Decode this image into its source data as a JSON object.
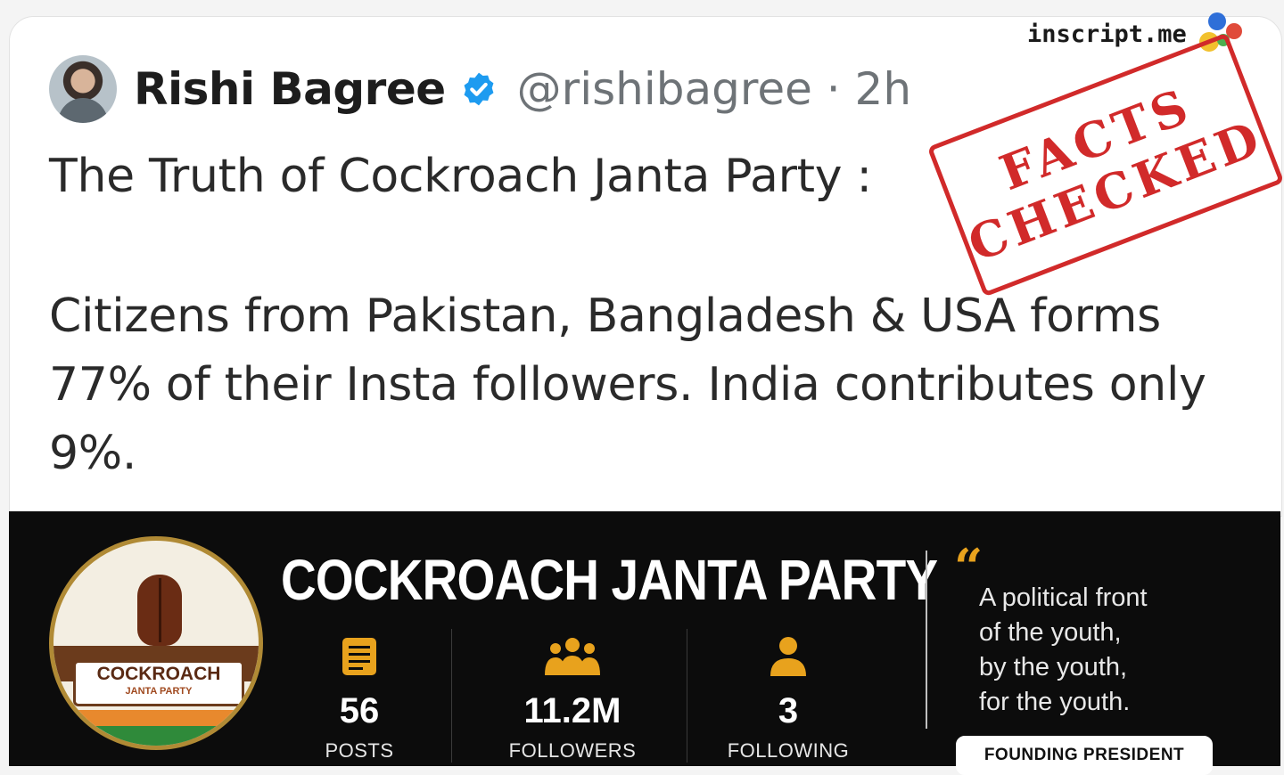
{
  "tweet": {
    "author_name": "Rishi Bagree",
    "handle_time": "@rishibagree · 2h",
    "paragraphs": [
      "The Truth of Cockroach Janta Party :",
      "Citizens from Pakistan, Bangladesh & USA forms 77% of their Insta followers. India contributes only 9%."
    ]
  },
  "watermark": {
    "text": "inscript.me",
    "dot_colors": [
      "#2f6fd8",
      "#e04a3a",
      "#f2c12e",
      "#4caf50"
    ]
  },
  "stamp": {
    "line1": "FACTS",
    "line2": "CHECKED",
    "color": "#d12a2a"
  },
  "banner": {
    "title": "COCKROACH JANTA PARTY",
    "logo": {
      "main": "COCKROACH",
      "sub": "JANTA PARTY"
    },
    "stats": [
      {
        "value": "56",
        "label": "POSTS",
        "icon": "posts-icon"
      },
      {
        "value": "11.2M",
        "label": "FOLLOWERS",
        "icon": "group-icon"
      },
      {
        "value": "3",
        "label": "FOLLOWING",
        "icon": "person-icon"
      }
    ],
    "quote_lines": [
      "A political front",
      "of the youth,",
      "by the youth,",
      "for the youth."
    ],
    "founder_label": "FOUNDING PRESIDENT",
    "accent": "#e8a21d"
  }
}
